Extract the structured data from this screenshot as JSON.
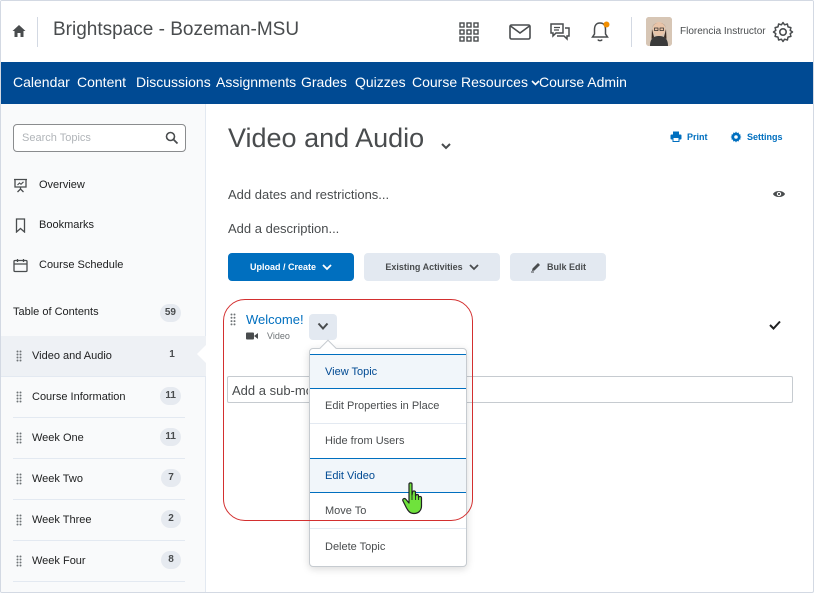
{
  "colors": {
    "nav_bg": "#004a93",
    "primary": "#006fbf",
    "outline": "#d32f2f",
    "notification_dot": "#f18e00"
  },
  "header": {
    "org_title": "Brightspace - Bozeman-MSU",
    "user_name": "Florencia Instructor",
    "icons": [
      "home-icon",
      "waffle-grid-icon",
      "mail-icon",
      "chat-icon",
      "bell-icon",
      "gear-icon"
    ]
  },
  "nav": {
    "items": [
      "Calendar",
      "Content",
      "Discussions",
      "Assignments",
      "Grades",
      "Quizzes",
      "Course Resources",
      "Course Admin"
    ]
  },
  "sidebar": {
    "search_placeholder": "Search Topics",
    "links": [
      "Overview",
      "Bookmarks",
      "Course Schedule"
    ],
    "toc_label": "Table of Contents",
    "toc_count": "59",
    "modules": [
      {
        "label": "Video and Audio",
        "count": "1"
      },
      {
        "label": "Course Information",
        "count": "11"
      },
      {
        "label": "Week One",
        "count": "11"
      },
      {
        "label": "Week Two",
        "count": "7"
      },
      {
        "label": "Week Three",
        "count": "2"
      },
      {
        "label": "Week Four",
        "count": "8"
      }
    ]
  },
  "main": {
    "title": "Video and Audio",
    "print_label": "Print",
    "settings_label": "Settings",
    "add_dates": "Add dates and restrictions...",
    "add_description": "Add a description...",
    "buttons": {
      "upload": "Upload / Create",
      "existing": "Existing Activities",
      "bulk_edit": "Bulk Edit"
    },
    "topic": {
      "title": "Welcome!",
      "type": "Video"
    },
    "submodule_placeholder": "Add a sub-mo"
  },
  "menu": {
    "items": [
      "View Topic",
      "Edit Properties in Place",
      "Hide from Users",
      "Edit Video",
      "Move To",
      "Delete Topic"
    ]
  }
}
